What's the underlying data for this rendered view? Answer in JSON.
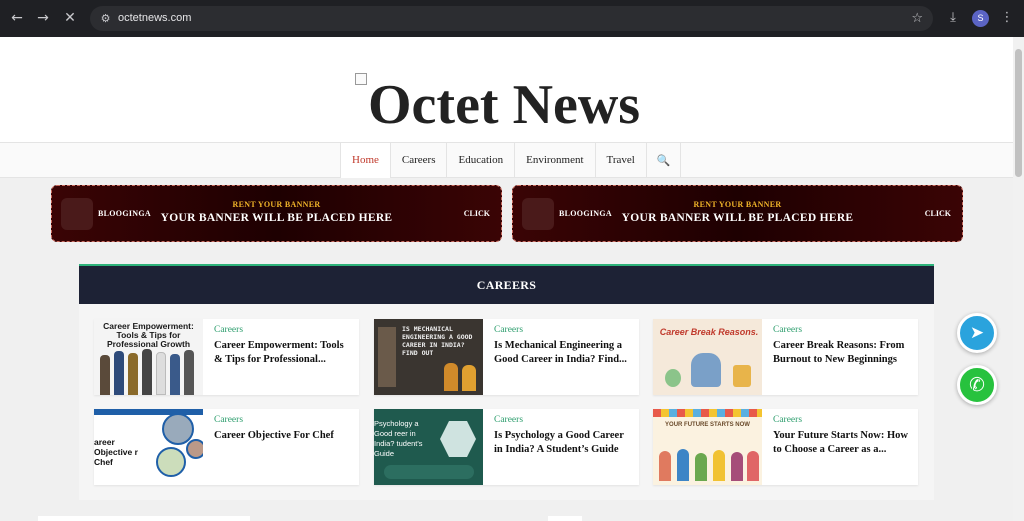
{
  "browser": {
    "url": "octetnews.com",
    "profile_initial": "S",
    "back_glyph": "←",
    "forward_glyph": "→",
    "stop_glyph": "✕",
    "star_glyph": "☆",
    "download_glyph": "⤓",
    "menu_glyph": "⋮",
    "site_info_glyph": "⚙"
  },
  "site": {
    "logo_text": "Octet News"
  },
  "nav": {
    "items": [
      {
        "label": "Home",
        "active": true
      },
      {
        "label": "Careers"
      },
      {
        "label": "Education"
      },
      {
        "label": "Environment"
      },
      {
        "label": "Travel"
      },
      {
        "label": "🔍"
      }
    ]
  },
  "banners": [
    {
      "brand": "BLOOGINGA",
      "rent": "RENT YOUR BANNER",
      "main": "YOUR BANNER WILL BE PLACED HERE",
      "click": "CLICK"
    },
    {
      "brand": "BLOOGINGA",
      "rent": "RENT YOUR BANNER",
      "main": "YOUR BANNER WILL BE PLACED HERE",
      "click": "CLICK"
    }
  ],
  "section": {
    "title": "CAREERS",
    "cards": [
      {
        "category": "Careers",
        "title": "Career Empowerment: Tools & Tips for Professional...",
        "img_text": "Career Empowerment: Tools & Tips for Professional Growth"
      },
      {
        "category": "Careers",
        "title": "Is Mechanical Engineering a Good Career in India? Find...",
        "img_text": "IS MECHANICAL ENGINEERING A GOOD CAREER IN INDIA? FIND OUT"
      },
      {
        "category": "Careers",
        "title": "Career Break Reasons: From Burnout to New Beginnings",
        "img_text": "Career Break Reasons."
      },
      {
        "category": "Careers",
        "title": "Career Objective For Chef",
        "img_text": "areer Objective r Chef"
      },
      {
        "category": "Careers",
        "title": "Is Psychology a Good Career in India? A Student’s Guide",
        "img_text": "Psychology a Good reer in India? tudent's Guide"
      },
      {
        "category": "Careers",
        "title": "Your Future Starts Now: How to Choose a Career as a...",
        "img_text": "YOUR FUTURE STARTS NOW"
      }
    ]
  },
  "floating": {
    "telegram_glyph": "➤",
    "whatsapp_glyph": "✆"
  },
  "colors": {
    "accent": "#c0392b",
    "section_head": "#1d2235",
    "category_green": "#2e9e6e",
    "banner_gold": "#f0b429",
    "telegram": "#2aa3dd",
    "whatsapp": "#27c23e"
  }
}
